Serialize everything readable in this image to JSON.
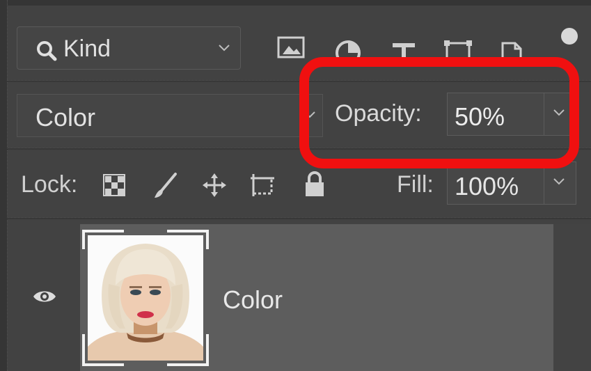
{
  "filter": {
    "kind_label": "Kind",
    "icons": [
      "image-filter-icon",
      "adjustment-filter-icon",
      "type-filter-icon",
      "shape-filter-icon",
      "smart-object-filter-icon"
    ]
  },
  "blend": {
    "mode": "Color",
    "opacity_label": "Opacity:",
    "opacity_value": "50%"
  },
  "lock": {
    "label": "Lock:",
    "icons": [
      "lock-transparent-pixels-icon",
      "lock-image-pixels-icon",
      "lock-position-icon",
      "lock-artboard-icon",
      "lock-all-icon"
    ],
    "fill_label": "Fill:",
    "fill_value": "100%"
  },
  "layer": {
    "name": "Color",
    "visible": true
  },
  "colors": {
    "panel_bg": "#424242",
    "layer_selected_bg": "#5d5d5d",
    "highlight": "#f01010"
  }
}
